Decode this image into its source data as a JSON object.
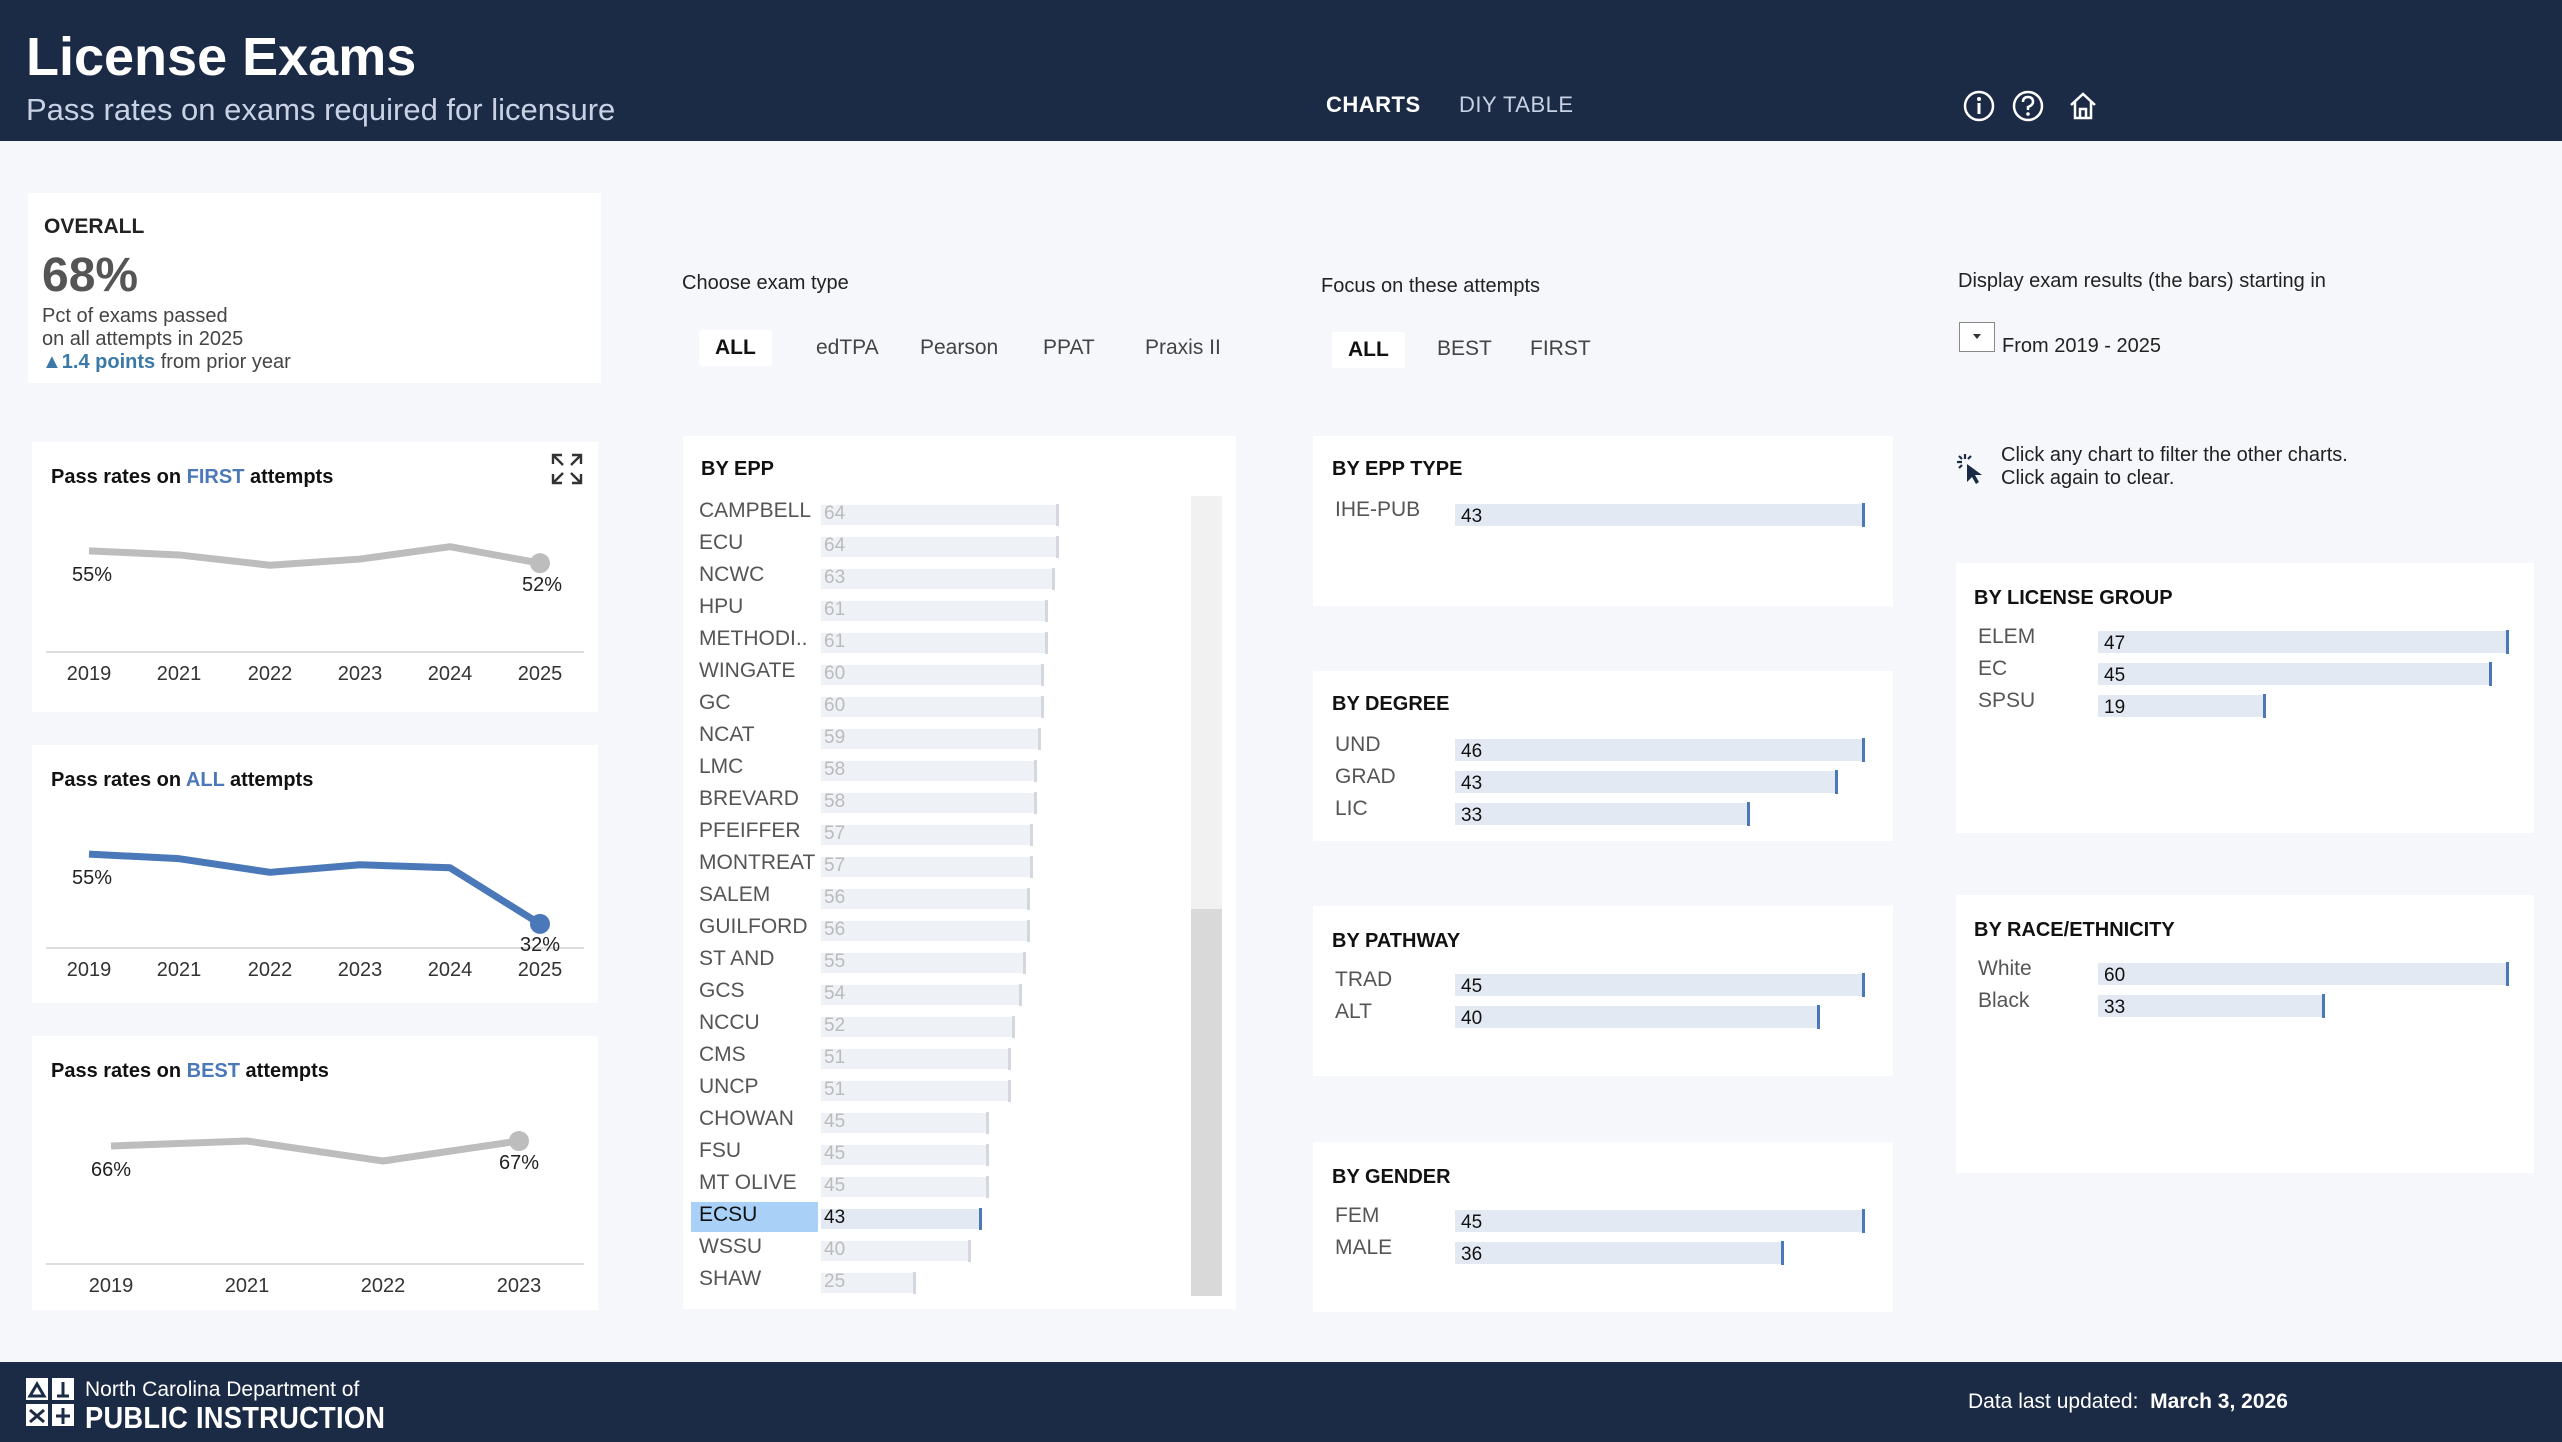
{
  "header": {
    "title": "License Exams",
    "subtitle": "Pass rates on exams required for licensure",
    "nav": [
      {
        "label": "CHARTS"
      },
      {
        "label": "DIY TABLE"
      }
    ]
  },
  "overall": {
    "heading": "OVERALL",
    "value": "68%",
    "line1": "Pct of exams passed",
    "line2": "on all attempts in 2025",
    "change": "▲1.4 points",
    "change_suffix": "from prior year"
  },
  "trend_cards": [
    {
      "prefix": "Pass rates on",
      "highlight": "FIRST",
      "suffix": "attempts",
      "years": [
        "2019",
        "2021",
        "2022",
        "2023",
        "2024",
        "2025"
      ],
      "values": [
        55,
        54,
        51.5,
        53,
        56,
        52
      ],
      "first_label": "55%",
      "last_label": "52%"
    },
    {
      "prefix": "Pass rates on",
      "highlight": "ALL",
      "suffix": "attempts",
      "years": [
        "2019",
        "2021",
        "2022",
        "2023",
        "2024",
        "2025"
      ],
      "values": [
        55,
        53.5,
        49,
        51.5,
        50.5,
        32
      ],
      "first_label": "55%",
      "last_label": "32%"
    },
    {
      "prefix": "Pass rates on",
      "highlight": "BEST",
      "suffix": "attempts",
      "years": [
        "2019",
        "2021",
        "2022",
        "2023"
      ],
      "values": [
        66,
        67,
        63,
        67
      ],
      "first_label": "66%",
      "last_label": "67%"
    }
  ],
  "filters": {
    "exam_type_label": "Choose exam type",
    "exam_types": [
      "ALL",
      "edTPA",
      "Pearson",
      "PPAT",
      "Praxis II"
    ],
    "attempts_label": "Focus on these attempts",
    "attempts": [
      "ALL",
      "BEST",
      "FIRST"
    ],
    "start_label": "Display exam results (the bars) starting in",
    "start_value": "From 2019 - 2025",
    "hint_line1": "Click any chart to filter the other charts.",
    "hint_line2": "Click again to clear."
  },
  "by_epp": {
    "title": "BY EPP",
    "rows": [
      {
        "name": "CAMPBELL",
        "value": 64
      },
      {
        "name": "ECU",
        "value": 64
      },
      {
        "name": "NCWC",
        "value": 63
      },
      {
        "name": "HPU",
        "value": 61
      },
      {
        "name": "METHODI..",
        "value": 61
      },
      {
        "name": "WINGATE",
        "value": 60
      },
      {
        "name": "GC",
        "value": 60
      },
      {
        "name": "NCAT",
        "value": 59
      },
      {
        "name": "LMC",
        "value": 58
      },
      {
        "name": "BREVARD",
        "value": 58
      },
      {
        "name": "PFEIFFER",
        "value": 57
      },
      {
        "name": "MONTREAT",
        "value": 57
      },
      {
        "name": "SALEM",
        "value": 56
      },
      {
        "name": "GUILFORD",
        "value": 56
      },
      {
        "name": "ST AND",
        "value": 55
      },
      {
        "name": "GCS",
        "value": 54
      },
      {
        "name": "NCCU",
        "value": 52
      },
      {
        "name": "CMS",
        "value": 51
      },
      {
        "name": "UNCP",
        "value": 51
      },
      {
        "name": "CHOWAN",
        "value": 45
      },
      {
        "name": "FSU",
        "value": 45
      },
      {
        "name": "MT OLIVE",
        "value": 45
      },
      {
        "name": "ECSU",
        "value": 43
      },
      {
        "name": "WSSU",
        "value": 40
      },
      {
        "name": "SHAW",
        "value": 25
      }
    ],
    "selected": "ECSU"
  },
  "by_epp_type": {
    "title": "BY EPP TYPE",
    "rows": [
      {
        "name": "IHE-PUB",
        "value": 43
      }
    ]
  },
  "by_degree": {
    "title": "BY DEGREE",
    "rows": [
      {
        "name": "UND",
        "value": 46
      },
      {
        "name": "GRAD",
        "value": 43
      },
      {
        "name": "LIC",
        "value": 33
      }
    ]
  },
  "by_pathway": {
    "title": "BY PATHWAY",
    "rows": [
      {
        "name": "TRAD",
        "value": 45
      },
      {
        "name": "ALT",
        "value": 40
      }
    ]
  },
  "by_gender": {
    "title": "BY GENDER",
    "rows": [
      {
        "name": "FEM",
        "value": 45
      },
      {
        "name": "MALE",
        "value": 36
      }
    ]
  },
  "by_license_group": {
    "title": "BY LICENSE GROUP",
    "rows": [
      {
        "name": "ELEM",
        "value": 47
      },
      {
        "name": "EC",
        "value": 45
      },
      {
        "name": "SPSU",
        "value": 19
      }
    ]
  },
  "by_race": {
    "title": "BY RACE/ETHNICITY",
    "rows": [
      {
        "name": "White",
        "value": 60
      },
      {
        "name": "Black",
        "value": 33
      }
    ]
  },
  "footer": {
    "org_line1": "North Carolina Department of",
    "org_line2": "PUBLIC INSTRUCTION",
    "updated_label": "Data last updated:",
    "updated_value": "March 3, 2026"
  },
  "colors": {
    "navy": "#1b2a45",
    "accent": "#4a78b8",
    "gray_line": "#bdbdbd",
    "selected_row": "#a9d1f7"
  },
  "icons": [
    "info-icon",
    "help-icon",
    "home-icon",
    "expand-icon",
    "pointer-click-icon",
    "dpi-logo-icon"
  ]
}
